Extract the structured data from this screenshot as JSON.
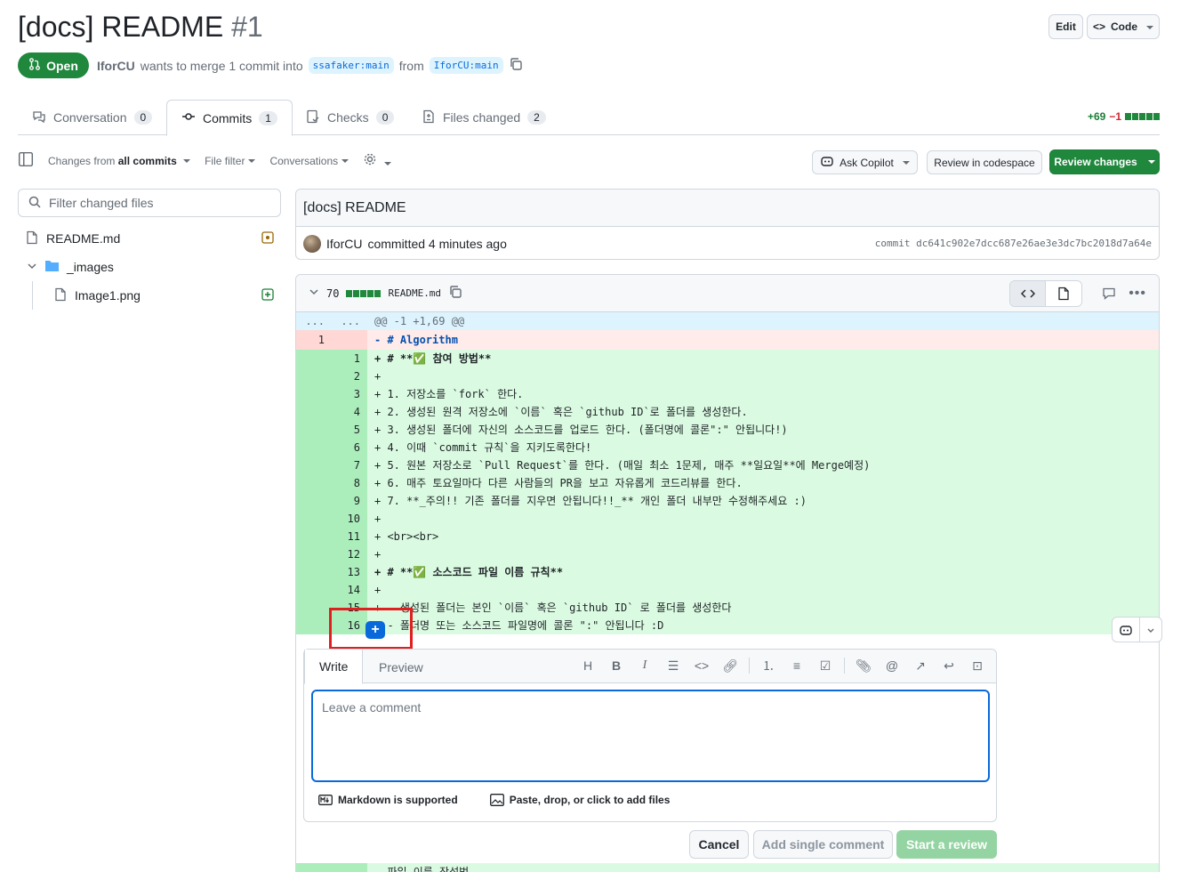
{
  "pr": {
    "title": "[docs] README",
    "number": "#1",
    "state": "Open",
    "author": "IforCU",
    "merge_text": "wants to merge 1 commit into",
    "base_branch": "ssafaker:main",
    "from_text": "from",
    "head_branch": "IforCU:main"
  },
  "header_buttons": {
    "edit": "Edit",
    "code": "Code"
  },
  "tabs": [
    {
      "label": "Conversation",
      "count": "0"
    },
    {
      "label": "Commits",
      "count": "1"
    },
    {
      "label": "Checks",
      "count": "0"
    },
    {
      "label": "Files changed",
      "count": "2"
    }
  ],
  "diffstat": {
    "additions": "+69",
    "deletions": "−1"
  },
  "toolbar": {
    "changes_prefix": "Changes from",
    "changes_value": "all commits",
    "file_filter": "File filter",
    "conversations": "Conversations",
    "ask_copilot": "Ask Copilot",
    "review_codespace": "Review in codespace",
    "review_changes": "Review changes"
  },
  "sidebar": {
    "filter_placeholder": "Filter changed files",
    "files": [
      {
        "name": "README.md"
      },
      {
        "name": "_images"
      },
      {
        "name": "Image1.png"
      }
    ]
  },
  "commit": {
    "title": "[docs] README",
    "author": "IforCU",
    "action": "committed 4 minutes ago",
    "sha_label": "commit dc641c902e7dcc687e26ae3e3dc7bc2018d7a64e"
  },
  "file": {
    "changes": "70",
    "name": "README.md",
    "hunk": "@@ -1 +1,69 @@",
    "hunk_dots": "..."
  },
  "diff_lines": [
    {
      "type": "del",
      "old": "1",
      "new": "",
      "text": "- # Algorithm"
    },
    {
      "type": "add",
      "old": "",
      "new": "1",
      "text": "+ # **✅ 참여 방법**"
    },
    {
      "type": "add",
      "old": "",
      "new": "2",
      "text": "+"
    },
    {
      "type": "add",
      "old": "",
      "new": "3",
      "text": "+ 1. 저장소를 `fork` 한다."
    },
    {
      "type": "add",
      "old": "",
      "new": "4",
      "text": "+ 2. 생성된 원격 저장소에 `이름` 혹은 `github ID`로 폴더를 생성한다."
    },
    {
      "type": "add",
      "old": "",
      "new": "5",
      "text": "+ 3. 생성된 폴더에 자신의 소스코드를 업로드 한다. (폴더명에 콜론\":\" 안됩니다!)"
    },
    {
      "type": "add",
      "old": "",
      "new": "6",
      "text": "+ 4. 이때 `commit 규칙`을 지키도록한다!"
    },
    {
      "type": "add",
      "old": "",
      "new": "7",
      "text": "+ 5. 원본 저장소로 `Pull Request`를 한다. (매일 최소 1문제, 매주 **일요일**에 Merge예정)"
    },
    {
      "type": "add",
      "old": "",
      "new": "8",
      "text": "+ 6. 매주 토요일마다 다른 사람들의 PR을 보고 자유롭게 코드리뷰를 한다."
    },
    {
      "type": "add",
      "old": "",
      "new": "9",
      "text": "+ 7. **_주의!! 기존 폴더를 지우면 안됩니다!!_** 개인 폴더 내부만 수정해주세요 :)"
    },
    {
      "type": "add",
      "old": "",
      "new": "10",
      "text": "+"
    },
    {
      "type": "add",
      "old": "",
      "new": "11",
      "text": "+ <br><br>"
    },
    {
      "type": "add",
      "old": "",
      "new": "12",
      "text": "+"
    },
    {
      "type": "add",
      "old": "",
      "new": "13",
      "text": "+ # **✅ 소스코드 파일 이름 규칙**"
    },
    {
      "type": "add",
      "old": "",
      "new": "14",
      "text": "+"
    },
    {
      "type": "add",
      "old": "",
      "new": "15",
      "text": "+ - 생성된 폴더는 본인 `이름` 혹은 `github ID` 로 폴더를 생성한다"
    },
    {
      "type": "add",
      "old": "",
      "new": "16",
      "text": "+ - 폴더명 또는 소스코드 파일명에 콜론 \":\" 안됩니다 :D"
    }
  ],
  "comment": {
    "write_tab": "Write",
    "preview_tab": "Preview",
    "placeholder": "Leave a comment",
    "markdown_note": "Markdown is supported",
    "attach_note": "Paste, drop, or click to add files",
    "cancel": "Cancel",
    "add_single": "Add single comment",
    "start_review": "Start a review"
  },
  "next_line_hint": "- 파일 이름 작성법",
  "colors": {
    "open_green": "#1f883d",
    "link_blue": "#0969da",
    "add_bg": "#dafbe1",
    "del_bg": "#ffebe9",
    "highlight_red": "#e02020"
  }
}
